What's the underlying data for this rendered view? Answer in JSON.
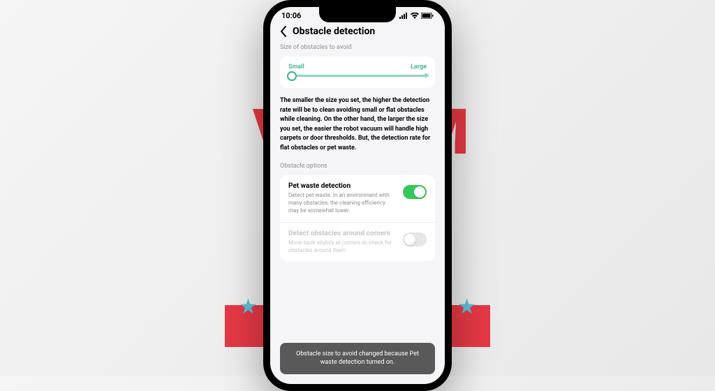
{
  "status": {
    "time": "10:06"
  },
  "header": {
    "title": "Obstacle detection"
  },
  "slider": {
    "section_label": "Size of obstacles to avoid",
    "min_label": "Small",
    "max_label": "Large"
  },
  "description": "The smaller the size you set, the higher the detection rate will be to clean avoiding small or flat obstacles while cleaning. On the other hand, the larger the size you set, the easier the robot vacuum will handle high carpets or door thresholds. But, the detection rate for flat obstacles or pet waste.",
  "options": {
    "section_label": "Obstacle options",
    "pet": {
      "title": "Pet waste detection",
      "desc": "Detect pet waste. In an environment with many obstacles, the cleaning efficiency may be somewhat lower.",
      "enabled": true
    },
    "corners": {
      "title": "Detect obstacles around corners",
      "desc": "Move back slightly at corners to check for obstacles around them.",
      "enabled": false
    }
  },
  "toast": "Obstacle size to avoid changed because Pet waste detection turned on."
}
